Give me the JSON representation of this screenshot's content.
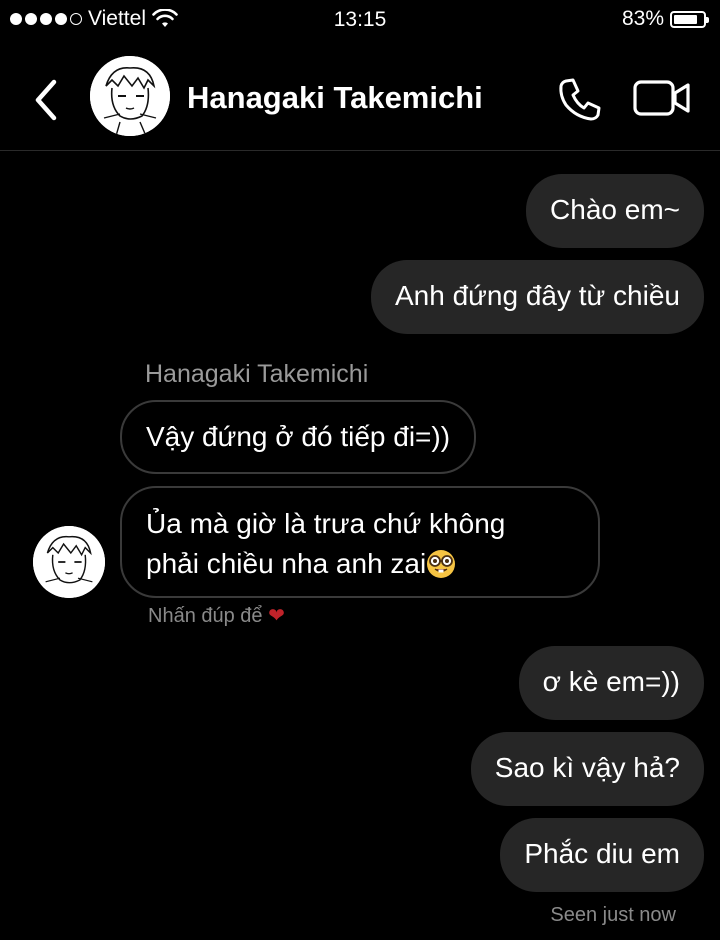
{
  "status_bar": {
    "carrier": "Viettel",
    "time": "13:15",
    "battery": "83%",
    "battery_level": 0.83,
    "signal_bars": 4
  },
  "header": {
    "contact_name": "Hanagaki Takemichi",
    "back_icon": "chevron-left-icon",
    "call_icon": "phone-icon",
    "video_icon": "video-camera-icon"
  },
  "messages": {
    "m1": "Chào em~",
    "m2": "Anh đứng đây từ chiều",
    "sender_name": "Hanagaki Takemichi",
    "m3": "Vậy đứng ở đó tiếp đi=))",
    "m4_line1": "Ủa mà giờ là trưa chứ không",
    "m4_line2": "phải chiều nha anh zai",
    "m4_emoji": "nerd-face-emoji",
    "reaction_hint": "Nhấn đúp để",
    "reaction_icon": "heart-icon",
    "m5": "ơ kè em=))",
    "m6": "Sao kì vậy hả?",
    "m7": "Phắc diu em",
    "seen": "Seen just now"
  },
  "colors": {
    "background": "#000000",
    "outgoing_bubble": "#262626",
    "incoming_border": "#3a3a3a",
    "muted_text": "#9a9a9a",
    "heart": "#c0232a"
  }
}
